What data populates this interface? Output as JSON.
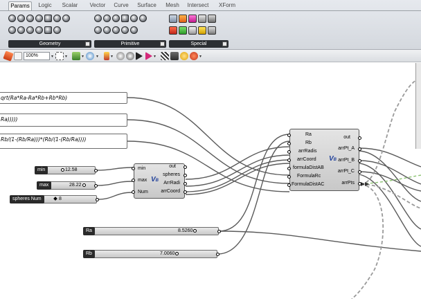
{
  "tabs": [
    "Params",
    "Logic",
    "Scalar",
    "Vector",
    "Curve",
    "Surface",
    "Mesh",
    "Intersect",
    "XForm"
  ],
  "active_tab": "Params",
  "ribbon_groups": [
    {
      "label": "Geometry"
    },
    {
      "label": "Primitive"
    },
    {
      "label": "Special"
    }
  ],
  "toolbar": {
    "zoom": "100%"
  },
  "panels": [
    {
      "text": "qrt(Ra*Ra-Ra*Rb+Rb*Rb)"
    },
    {
      "text": "Ra)))))"
    },
    {
      "text": "Rb/(1-(Rb/Ra)))*(Rb/(1-(Rb/Ra))))"
    }
  ],
  "sliders": {
    "min": {
      "label": "min",
      "value": "12.58"
    },
    "max": {
      "label": "max",
      "value": "28.22"
    },
    "spheres_num": {
      "label": "spheres Num",
      "value": "8"
    },
    "ra": {
      "label": "Ra",
      "value": "8.5260"
    },
    "rb": {
      "label": "Rb",
      "value": "7.0060"
    }
  },
  "vb_small": {
    "inputs": [
      "min",
      "max",
      "Num"
    ],
    "outputs": [
      "out",
      "spheres",
      "ArrRadi",
      "arrCoord"
    ],
    "badge": "V"
  },
  "vb_big": {
    "inputs": [
      "Ra",
      "Rb",
      "arrRadis",
      "arrCoord",
      "formulaDistAB",
      "FormulaRc",
      "FormulaDistAC"
    ],
    "outputs": [
      "out",
      "arrPt_A",
      "arrPt_B",
      "arrPt_C",
      "arrPts"
    ],
    "badge": "V"
  },
  "colors": {
    "ribbon": "#d9dde2",
    "group_label_bg": "#2c2f33",
    "wire": "#5a5a5a",
    "component_fill": "#d4d4d4",
    "vb_badge": "#1f3f9a"
  }
}
